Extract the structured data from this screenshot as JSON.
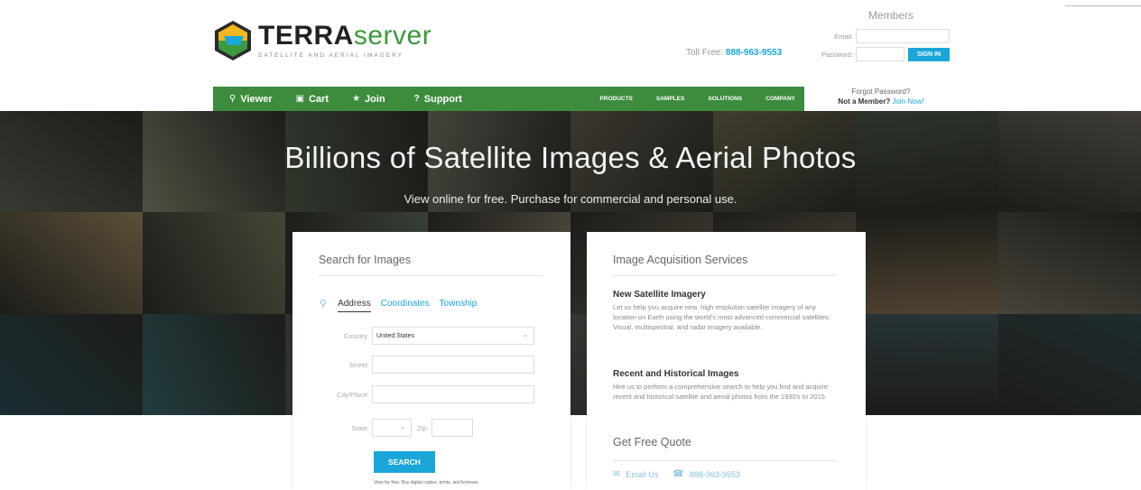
{
  "header": {
    "logo_brand_bold": "TERRA",
    "logo_brand_light": "server",
    "logo_tagline": "SATELLITE AND AERIAL IMAGERY",
    "toll_free_label": "Toll Free:",
    "toll_free_number": "888-963-9553"
  },
  "members": {
    "title": "Members",
    "email_label": "Email:",
    "password_label": "Password:",
    "signin_label": "SIGN IN",
    "forgot_label": "Forgot Password?",
    "not_member_label": "Not a Member?",
    "join_now_label": "Join Now!"
  },
  "nav": {
    "main": [
      {
        "icon": "search-icon",
        "glyph": "🔍",
        "label": "Viewer"
      },
      {
        "icon": "cart-icon",
        "glyph": "🛒",
        "label": "Cart"
      },
      {
        "icon": "star-icon",
        "glyph": "★",
        "label": "Join"
      },
      {
        "icon": "question-icon",
        "glyph": "?",
        "label": "Support"
      }
    ],
    "secondary": [
      "PRODUCTS",
      "SAMPLES",
      "SOLUTIONS",
      "COMPANY"
    ]
  },
  "hero": {
    "title": "Billions of Satellite Images & Aerial Photos",
    "subtitle": "View online for free. Purchase for commercial and personal use.",
    "tile_colors": [
      "#4a4d44",
      "#6b6a5a",
      "#3f4a3b",
      "#5c5a4e",
      "#4e4a3e",
      "#57533f",
      "#3c4639",
      "#55514b",
      "#7a6a4c",
      "#5a5f4a",
      "#4b5546",
      "#6e6454",
      "#5b5344",
      "#736652",
      "#6a5a43",
      "#5e5a4d",
      "#223e44",
      "#2e5154",
      "#394438",
      "#3f4c4a",
      "#474a42",
      "#3b4a49",
      "#35454a",
      "#2a3b3f"
    ]
  },
  "search": {
    "title": "Search for Images",
    "tabs": [
      "Address",
      "Coordinates",
      "Township"
    ],
    "country_label": "Country:",
    "country_value": "United States",
    "street_label": "Street:",
    "city_label": "City/Place:",
    "state_label": "State:",
    "zip_label": "Zip:",
    "search_button": "SEARCH",
    "disclaimer": "View for free. Buy digital copies, prints, and licenses."
  },
  "acquisition": {
    "title": "Image Acquisition Services",
    "items": [
      {
        "heading": "New Satellite Imagery",
        "body": "Let us help you acquire new, high resolution satellite imagery of any location on Earth using the world's most advanced commercial satellites. Visual, multispectral, and radar imagery available."
      },
      {
        "heading": "Recent and Historical Images",
        "body": "Hire us to perform a comprehensive search to help you find and acquire recent and historical satellite and aerial photos from the 1930's to 2015."
      }
    ],
    "quote_title": "Get Free Quote",
    "email_link": "Email Us",
    "phone_link": "888-963-9553"
  }
}
